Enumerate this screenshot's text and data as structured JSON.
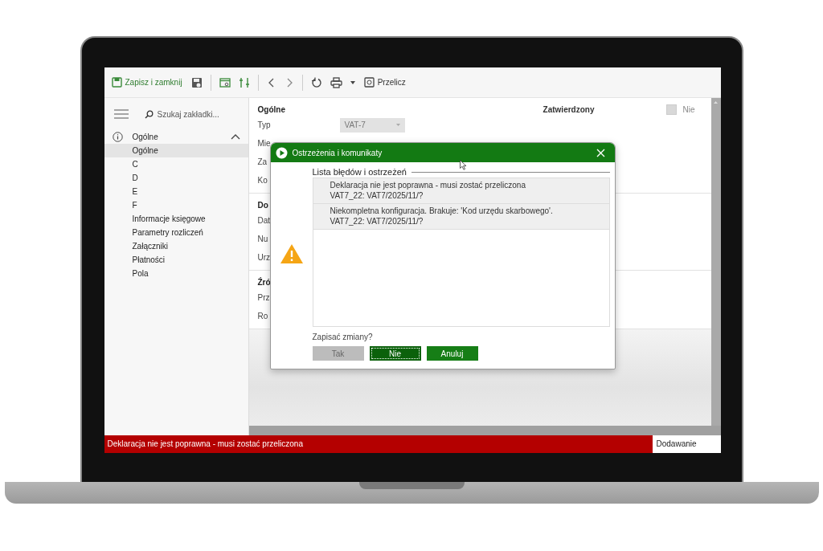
{
  "toolbar": {
    "save_close": "Zapisz i zamknij",
    "recalculate": "Przelicz"
  },
  "sidebar": {
    "search": {
      "placeholder": "Szukaj zakładki..."
    },
    "tree": [
      {
        "label": "Ogólne",
        "expanded": true,
        "children": [
          {
            "label": "Ogólne",
            "selected": true
          },
          {
            "label": "C",
            "selected": false
          },
          {
            "label": "D",
            "selected": false
          },
          {
            "label": "E",
            "selected": false
          },
          {
            "label": "F",
            "selected": false
          },
          {
            "label": "Informacje księgowe",
            "selected": false
          },
          {
            "label": "Parametry rozliczeń",
            "selected": false
          },
          {
            "label": "Załączniki",
            "selected": false
          },
          {
            "label": "Płatności",
            "selected": false
          },
          {
            "label": "Pola",
            "selected": false
          }
        ]
      }
    ]
  },
  "form": {
    "approved": {
      "label": "Zatwierdzony",
      "checked": false,
      "value": "Nie"
    },
    "sections": [
      {
        "title": "Ogólne",
        "rows": [
          {
            "label": "Typ",
            "value": "VAT-7"
          },
          {
            "label": "Mie"
          },
          {
            "label": "Za"
          },
          {
            "label": "Ko"
          }
        ]
      },
      {
        "title": "Do",
        "rows": [
          {
            "label": "Dat"
          },
          {
            "label": "Nu"
          },
          {
            "label": "Urz"
          }
        ]
      },
      {
        "title": "Źró",
        "rows": [
          {
            "label": "Prz"
          },
          {
            "label": "Ro"
          }
        ]
      }
    ]
  },
  "dialog": {
    "title": "Ostrzeżenia i komunikaty",
    "list_title": "Lista błędów i ostrzeżeń",
    "messages": [
      {
        "lines": [
          "Deklaracja nie jest poprawna - musi zostać przeliczona",
          "VAT7_22: VAT7/2025/11/?"
        ]
      },
      {
        "lines": [
          "Niekompletna konfiguracja. Brakuje: 'Kod urzędu skarbowego'.",
          "VAT7_22: VAT7/2025/11/?"
        ]
      }
    ],
    "question": "Zapisać zmiany?",
    "buttons": [
      {
        "label": "Tak",
        "disabled": true,
        "focused": false
      },
      {
        "label": "Nie",
        "disabled": false,
        "focused": true
      },
      {
        "label": "Anuluj",
        "disabled": false,
        "focused": false
      }
    ]
  },
  "status_bar": {
    "message": "Deklaracja nie jest poprawna - musi zostać przeliczona",
    "mode": "Dodawanie"
  }
}
